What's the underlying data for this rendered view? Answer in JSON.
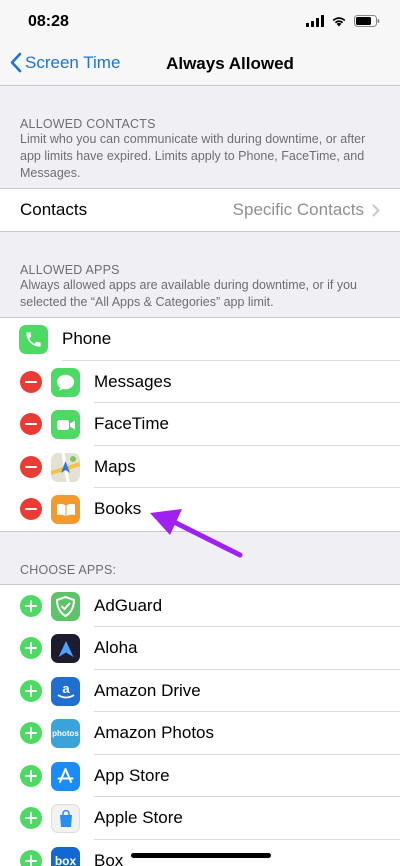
{
  "status": {
    "time": "08:28"
  },
  "nav": {
    "back_label": "Screen Time",
    "title": "Always Allowed"
  },
  "contacts_section": {
    "header": "ALLOWED CONTACTS",
    "description": "Limit who you can communicate with during downtime, or after app limits have expired. Limits apply to Phone, FaceTime, and Messages.",
    "row_label": "Contacts",
    "row_value": "Specific Contacts"
  },
  "allowed_section": {
    "header": "ALLOWED APPS",
    "description": "Always allowed apps are available during downtime, or if you selected the “All Apps & Categories” app limit.",
    "apps": [
      {
        "name": "Phone",
        "icon": "phone-icon",
        "color": "#4cd964"
      },
      {
        "name": "Messages",
        "icon": "messages-icon",
        "color": "#4cd964"
      },
      {
        "name": "FaceTime",
        "icon": "facetime-icon",
        "color": "#4cd964"
      },
      {
        "name": "Maps",
        "icon": "maps-icon",
        "color": "#e8e6df"
      },
      {
        "name": "Books",
        "icon": "books-icon",
        "color": "#f39a2c"
      }
    ]
  },
  "choose_section": {
    "header": "CHOOSE APPS:",
    "apps": [
      {
        "name": "AdGuard",
        "icon": "adguard-icon",
        "color": "#5ec268"
      },
      {
        "name": "Aloha",
        "icon": "aloha-icon",
        "color": "#1c1c2e"
      },
      {
        "name": "Amazon Drive",
        "icon": "amazon-drive-icon",
        "color": "#1f6fd1"
      },
      {
        "name": "Amazon Photos",
        "icon": "amazon-photos-icon",
        "color": "#3aa3d9"
      },
      {
        "name": "App Store",
        "icon": "app-store-icon",
        "color": "#1a8cf5"
      },
      {
        "name": "Apple Store",
        "icon": "apple-store-icon",
        "color": "#f2f2f2"
      },
      {
        "name": "Box",
        "icon": "box-icon",
        "color": "#1168d1"
      }
    ]
  },
  "icon_texts": {
    "amazon_photos": "photos",
    "box": "box"
  },
  "colors": {
    "accent": "#1a73d9",
    "remove": "#ec3b35",
    "add": "#4cd964",
    "annotation_arrow": "#a020f0"
  }
}
